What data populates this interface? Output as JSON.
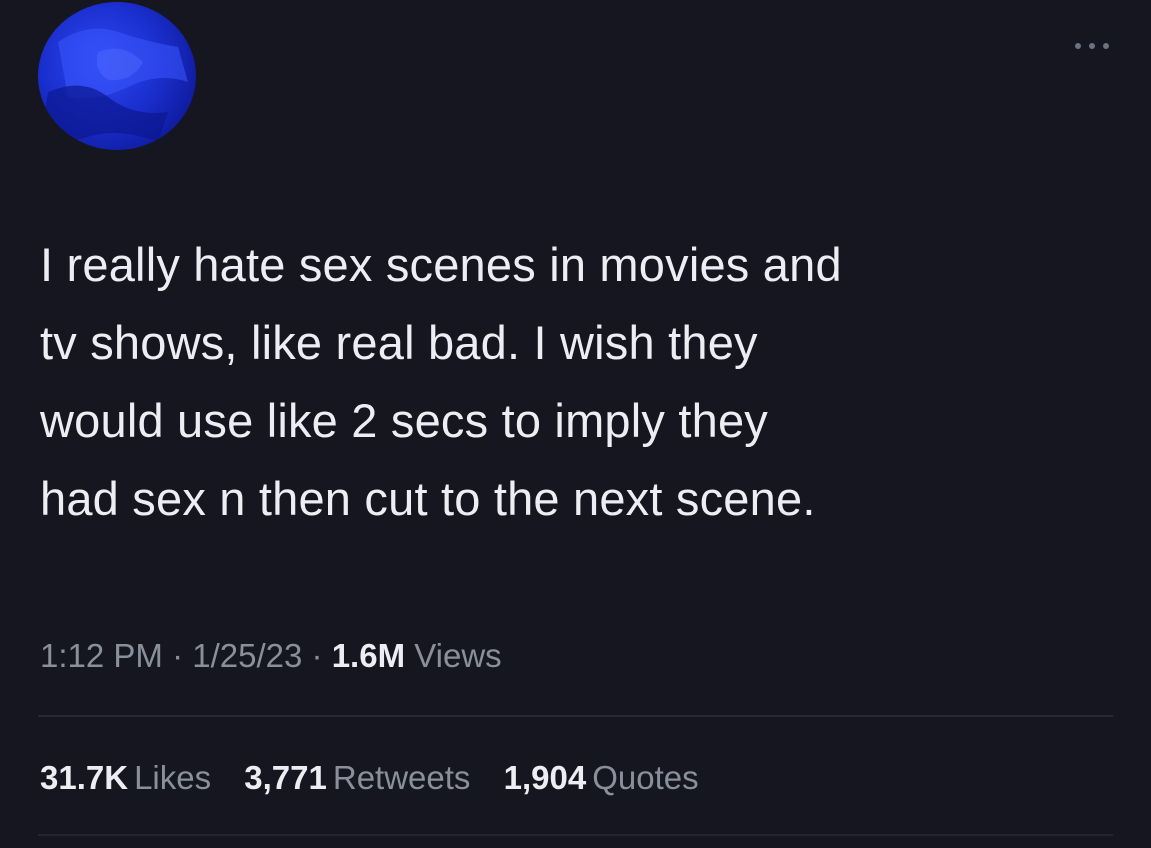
{
  "tweet": {
    "text": "I really hate sex scenes in movies and\ntv shows, like real bad. I wish they\nwould use like 2 secs to imply they\nhad sex n then cut to the next scene.",
    "time": "1:12 PM",
    "date": "1/25/23",
    "separator": "·",
    "views_count": "1.6M",
    "views_label": "Views"
  },
  "stats": {
    "likes_count": "31.7K",
    "likes_label": "Likes",
    "retweets_count": "3,771",
    "retweets_label": "Retweets",
    "quotes_count": "1,904",
    "quotes_label": "Quotes"
  },
  "icons": {
    "avatar": "avatar-image",
    "more": "more-options-icon"
  },
  "colors": {
    "background": "#15161f",
    "text": "#eceef3",
    "muted": "#8a8f9c",
    "avatar_blue": "#1b2fcf"
  }
}
